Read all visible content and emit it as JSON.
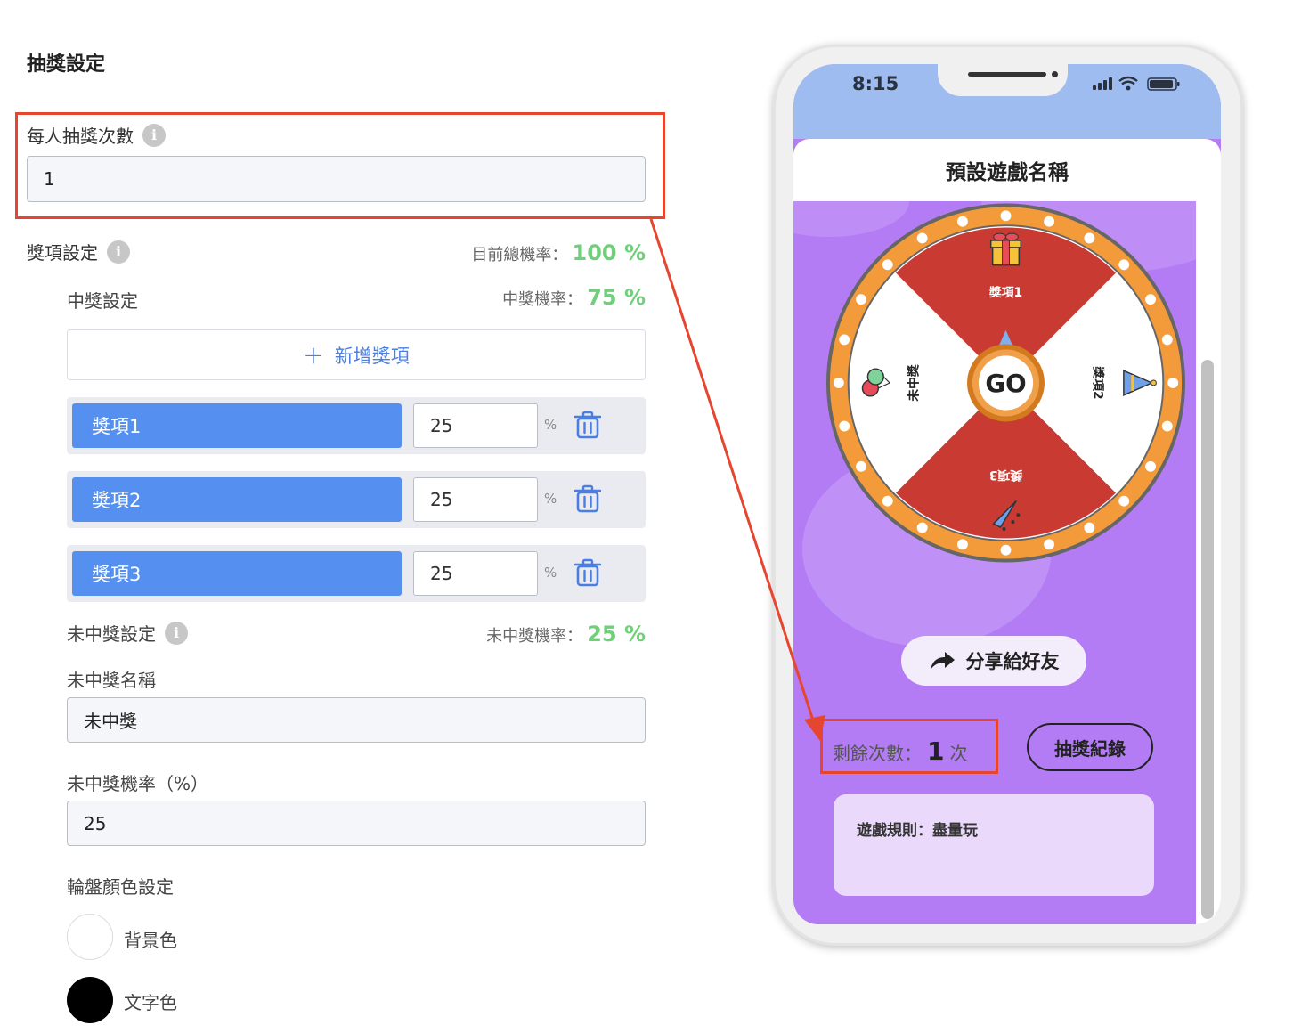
{
  "settings": {
    "section_title": "抽獎設定",
    "draws_per_person": {
      "label": "每人抽獎次數",
      "value": "1",
      "info": "i"
    },
    "prize_settings": {
      "label": "獎項設定",
      "info": "i",
      "total_rate_label": "目前總機率：",
      "total_rate_value": "100 %"
    },
    "win_settings": {
      "label": "中獎設定",
      "rate_label": "中獎機率：",
      "rate_value": "75 %"
    },
    "add_prize": {
      "plus": "+",
      "label": "新增獎項"
    },
    "prizes": [
      {
        "name": "獎項1",
        "percent": "25",
        "pct_symbol": "%"
      },
      {
        "name": "獎項2",
        "percent": "25",
        "pct_symbol": "%"
      },
      {
        "name": "獎項3",
        "percent": "25",
        "pct_symbol": "%"
      }
    ],
    "lose_settings": {
      "label": "未中獎設定",
      "info": "i",
      "rate_label": "未中獎機率：",
      "rate_value": "25 %"
    },
    "lose_name": {
      "label": "未中獎名稱",
      "value": "未中獎"
    },
    "lose_rate": {
      "label": "未中獎機率（%）",
      "value": "25"
    },
    "wheel_colors": {
      "label": "輪盤顏色設定",
      "background_label": "背景色",
      "text_label": "文字色",
      "background_color": "#ffffff",
      "text_color": "#000000"
    }
  },
  "phone": {
    "time": "8:15",
    "game_title": "預設遊戲名稱",
    "wheel": {
      "go_label": "GO",
      "segments": [
        {
          "label": "獎項1",
          "color": "#c93a33",
          "icon": "gift-icon"
        },
        {
          "label": "獎項2",
          "color": "#ffffff",
          "icon": "party-hat-icon"
        },
        {
          "label": "獎項3",
          "color": "#c93a33",
          "icon": "party-popper-icon"
        },
        {
          "label": "未中獎",
          "color": "#ffffff",
          "icon": "balloons-icon"
        }
      ],
      "rim_color": "#f39b3a"
    },
    "share_label": "分享給好友",
    "remaining_label": "剩餘次數：",
    "remaining_value": "1",
    "remaining_unit": "次",
    "record_label": "抽獎紀錄",
    "rules_text": "遊戲規則：盡量玩"
  },
  "colors": {
    "accent_blue": "#5590f0",
    "rate_green": "#6fd07a",
    "annotation_red": "#e64530",
    "screen_purple": "#b37cf5"
  }
}
